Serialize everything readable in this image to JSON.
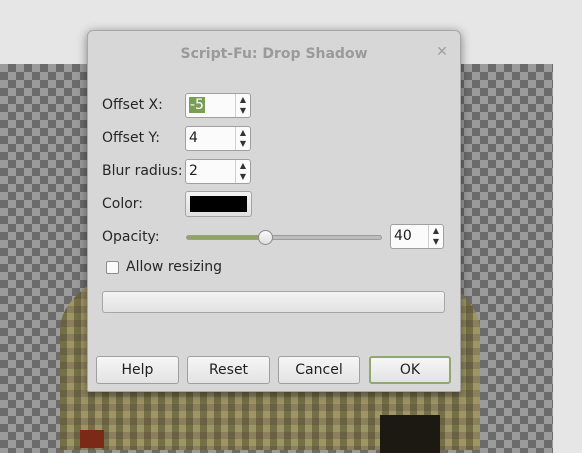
{
  "dialog": {
    "title": "Script-Fu: Drop Shadow",
    "close_icon": "close-icon",
    "fields": {
      "offset_x": {
        "label": "Offset X:",
        "value": "-5"
      },
      "offset_y": {
        "label": "Offset Y:",
        "value": "4"
      },
      "blur_radius": {
        "label": "Blur radius:",
        "value": "2"
      },
      "color": {
        "label": "Color:",
        "value": "#000000"
      },
      "opacity": {
        "label": "Opacity:",
        "value": "40",
        "slider_fraction": 0.4
      }
    },
    "allow_resizing": {
      "label": "Allow resizing",
      "checked": false
    },
    "progress_text": "",
    "buttons": {
      "help": "Help",
      "reset": "Reset",
      "cancel": "Cancel",
      "ok": "OK"
    }
  },
  "colors": {
    "accent": "#8aa862",
    "dialog_bg": "#d7d7d7",
    "title_text": "#9a9a9a"
  }
}
